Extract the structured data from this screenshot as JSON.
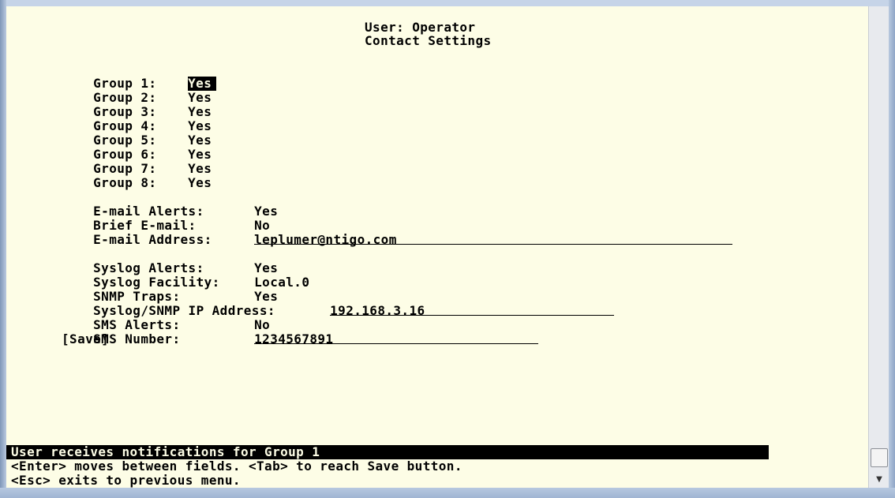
{
  "header": {
    "user_line": "User: Operator",
    "title": "Contact Settings"
  },
  "groups": [
    {
      "label": "Group 1:",
      "value": "Yes"
    },
    {
      "label": "Group 2:",
      "value": "Yes"
    },
    {
      "label": "Group 3:",
      "value": "Yes"
    },
    {
      "label": "Group 4:",
      "value": "Yes"
    },
    {
      "label": "Group 5:",
      "value": "Yes"
    },
    {
      "label": "Group 6:",
      "value": "Yes"
    },
    {
      "label": "Group 7:",
      "value": "Yes"
    },
    {
      "label": "Group 8:",
      "value": "Yes"
    }
  ],
  "email": {
    "alerts_label": "E-mail Alerts:",
    "alerts_value": "Yes",
    "brief_label": "Brief E-mail:",
    "brief_value": "No",
    "address_label": "E-mail Address:",
    "address_value": "leplumer@ntigo.com"
  },
  "syslog": {
    "alerts_label": "Syslog Alerts:",
    "alerts_value": "Yes",
    "facility_label": "Syslog Facility:",
    "facility_value": "Local.0",
    "snmp_label": "SNMP Traps:",
    "snmp_value": "Yes",
    "ip_label": "Syslog/SNMP IP Address:",
    "ip_value": "192.168.3.16",
    "sms_alerts_label": "SMS Alerts:",
    "sms_alerts_value": "No",
    "sms_number_label": "SMS Number:",
    "sms_number_value": "1234567891"
  },
  "save_label": "[Save]",
  "status": {
    "help": "User receives notifications for Group 1",
    "hint1": "<Enter> moves between fields. <Tab> to reach Save button.",
    "hint2": "<Esc> exits to previous menu."
  }
}
